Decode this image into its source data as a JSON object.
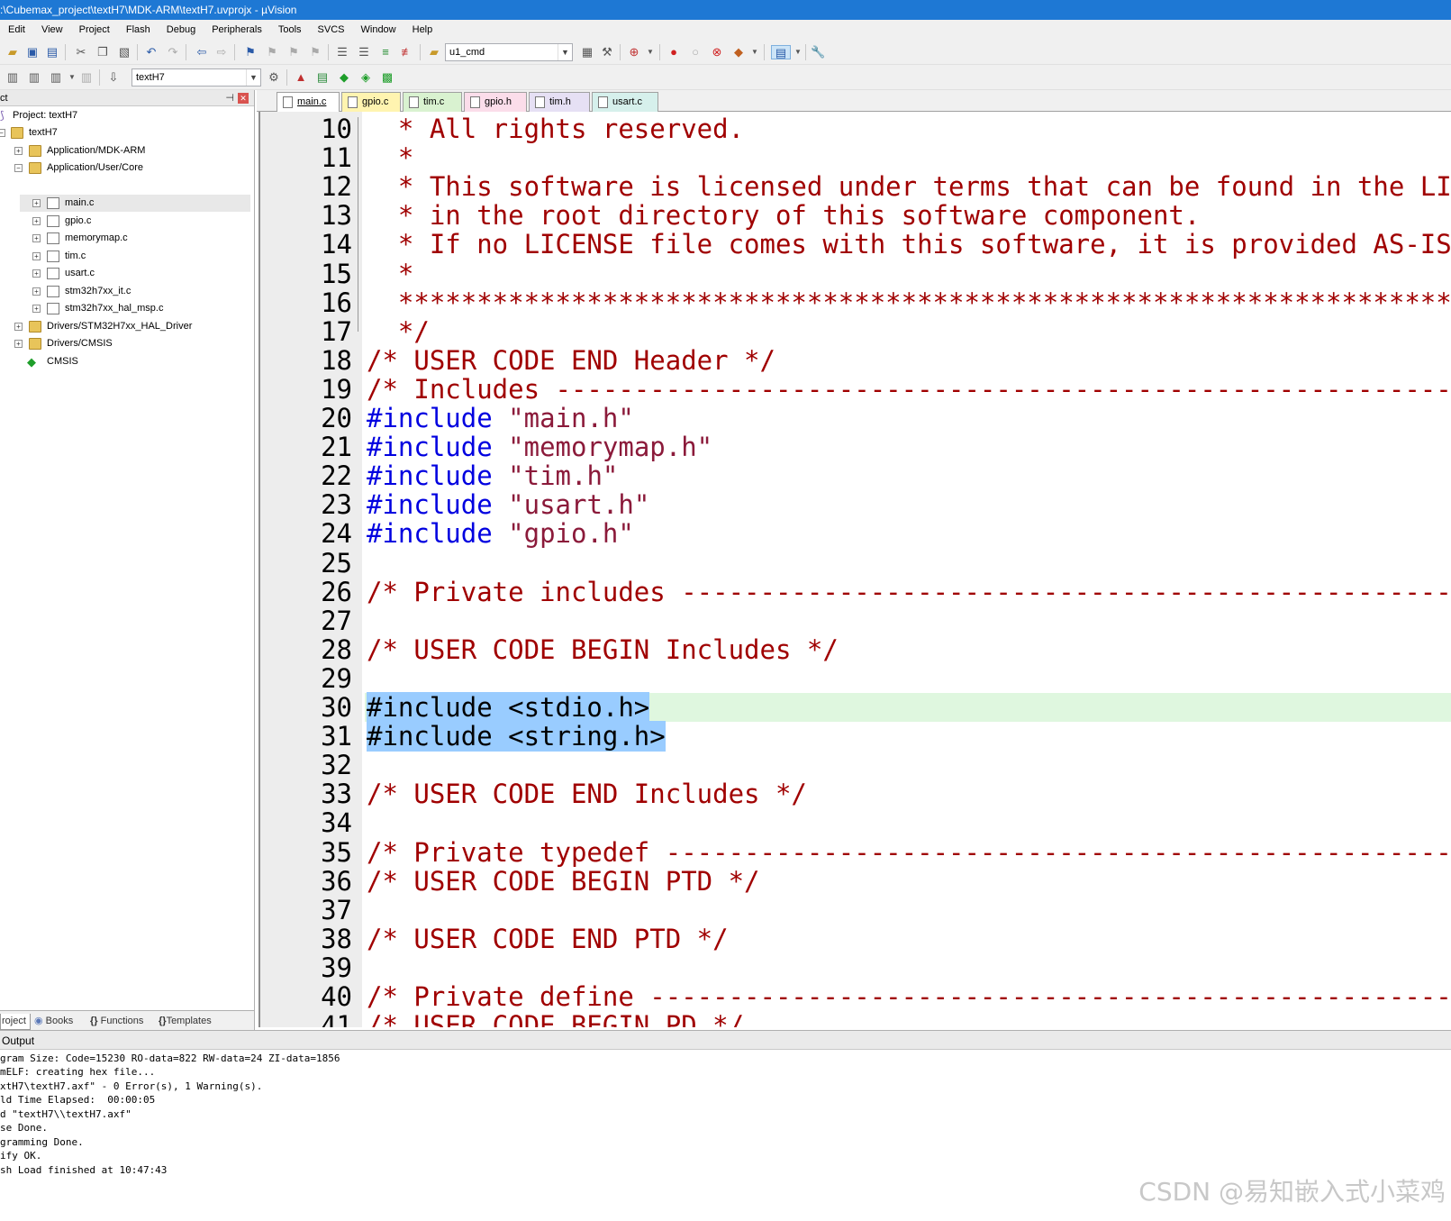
{
  "window": {
    "title": ":\\Cubemax_project\\textH7\\MDK-ARM\\textH7.uvprojx - µVision"
  },
  "menu": [
    "Edit",
    "View",
    "Project",
    "Flash",
    "Debug",
    "Peripherals",
    "Tools",
    "SVCS",
    "Window",
    "Help"
  ],
  "toolbar": {
    "command_combo": "u1_cmd",
    "target_combo": "textH7"
  },
  "project_panel": {
    "header": "ct",
    "tree": [
      {
        "label": "Project: textH7",
        "icon": "project-icon"
      },
      {
        "label": "textH7",
        "icon": "folder-icon"
      },
      {
        "label": "Application/MDK-ARM",
        "icon": "folder-icon"
      },
      {
        "label": "Application/User/Core",
        "icon": "folder-icon"
      },
      {
        "label": "main.c",
        "icon": "file-icon"
      },
      {
        "label": "gpio.c",
        "icon": "file-icon"
      },
      {
        "label": "memorymap.c",
        "icon": "file-icon"
      },
      {
        "label": "tim.c",
        "icon": "file-icon"
      },
      {
        "label": "usart.c",
        "icon": "file-icon"
      },
      {
        "label": "stm32h7xx_it.c",
        "icon": "file-icon"
      },
      {
        "label": "stm32h7xx_hal_msp.c",
        "icon": "file-icon"
      },
      {
        "label": "Drivers/STM32H7xx_HAL_Driver",
        "icon": "folder-icon"
      },
      {
        "label": "Drivers/CMSIS",
        "icon": "folder-icon"
      },
      {
        "label": "CMSIS",
        "icon": "cmsis-icon"
      }
    ],
    "tabs": [
      "roject",
      "Books",
      "Functions",
      "Templates"
    ]
  },
  "editor_tabs": [
    {
      "label": "main.c",
      "color": "#FFFFFF"
    },
    {
      "label": "gpio.c",
      "color": "#FFF4B0"
    },
    {
      "label": "tim.c",
      "color": "#D9F2D0"
    },
    {
      "label": "gpio.h",
      "color": "#FBDDEA"
    },
    {
      "label": "tim.h",
      "color": "#E6E0F4"
    },
    {
      "label": "usart.c",
      "color": "#D6F0EC"
    }
  ],
  "code_lines": [
    {
      "num": "10",
      "text": "  * All rights reserved."
    },
    {
      "num": "11",
      "text": "  *"
    },
    {
      "num": "12",
      "text": "  * This software is licensed under terms that can be found in the LICENSE"
    },
    {
      "num": "13",
      "text": "  * in the root directory of this software component."
    },
    {
      "num": "14",
      "text": "  * If no LICENSE file comes with this software, it is provided AS-IS."
    },
    {
      "num": "15",
      "text": "  *"
    },
    {
      "num": "16",
      "text": "  ********************************************************************************"
    },
    {
      "num": "17",
      "text": "  */"
    },
    {
      "num": "18",
      "text": "/* USER CODE END Header */"
    },
    {
      "num": "19",
      "text": "/* Includes ------------------------------------------------------------------"
    },
    {
      "num": "20",
      "pp": "#include",
      "str": "\"main.h\""
    },
    {
      "num": "21",
      "pp": "#include",
      "str": "\"memorymap.h\""
    },
    {
      "num": "22",
      "pp": "#include",
      "str": "\"tim.h\""
    },
    {
      "num": "23",
      "pp": "#include",
      "str": "\"usart.h\""
    },
    {
      "num": "24",
      "pp": "#include",
      "str": "\"gpio.h\""
    },
    {
      "num": "25",
      "text": ""
    },
    {
      "num": "26",
      "text": "/* Private includes ----------------------------------------------------------"
    },
    {
      "num": "27",
      "text": ""
    },
    {
      "num": "28",
      "text": "/* USER CODE BEGIN Includes */"
    },
    {
      "num": "29",
      "text": ""
    },
    {
      "num": "30",
      "sel": "#include <stdio.h>"
    },
    {
      "num": "31",
      "sel": "#include <string.h>"
    },
    {
      "num": "32",
      "text": ""
    },
    {
      "num": "33",
      "text": "/* USER CODE END Includes */"
    },
    {
      "num": "34",
      "text": ""
    },
    {
      "num": "35",
      "text": "/* Private typedef -----------------------------------------------------------"
    },
    {
      "num": "36",
      "text": "/* USER CODE BEGIN PTD */"
    },
    {
      "num": "37",
      "text": ""
    },
    {
      "num": "38",
      "text": "/* USER CODE END PTD */"
    },
    {
      "num": "39",
      "text": ""
    },
    {
      "num": "40",
      "text": "/* Private define ------------------------------------------------------------"
    },
    {
      "num": "41",
      "text": "/* USER CODE BEGIN PD */"
    }
  ],
  "output": {
    "title": "Output",
    "lines": [
      "gram Size: Code=15230 RO-data=822 RW-data=24 ZI-data=1856",
      "mELF: creating hex file...",
      "xtH7\\textH7.axf\" - 0 Error(s), 1 Warning(s).",
      "ld Time Elapsed:  00:00:05",
      "d \"textH7\\\\textH7.axf\"",
      "se Done.",
      "gramming Done.",
      "ify OK.",
      "sh Load finished at 10:47:43"
    ]
  },
  "watermark": "CSDN @易知嵌入式小菜鸡"
}
